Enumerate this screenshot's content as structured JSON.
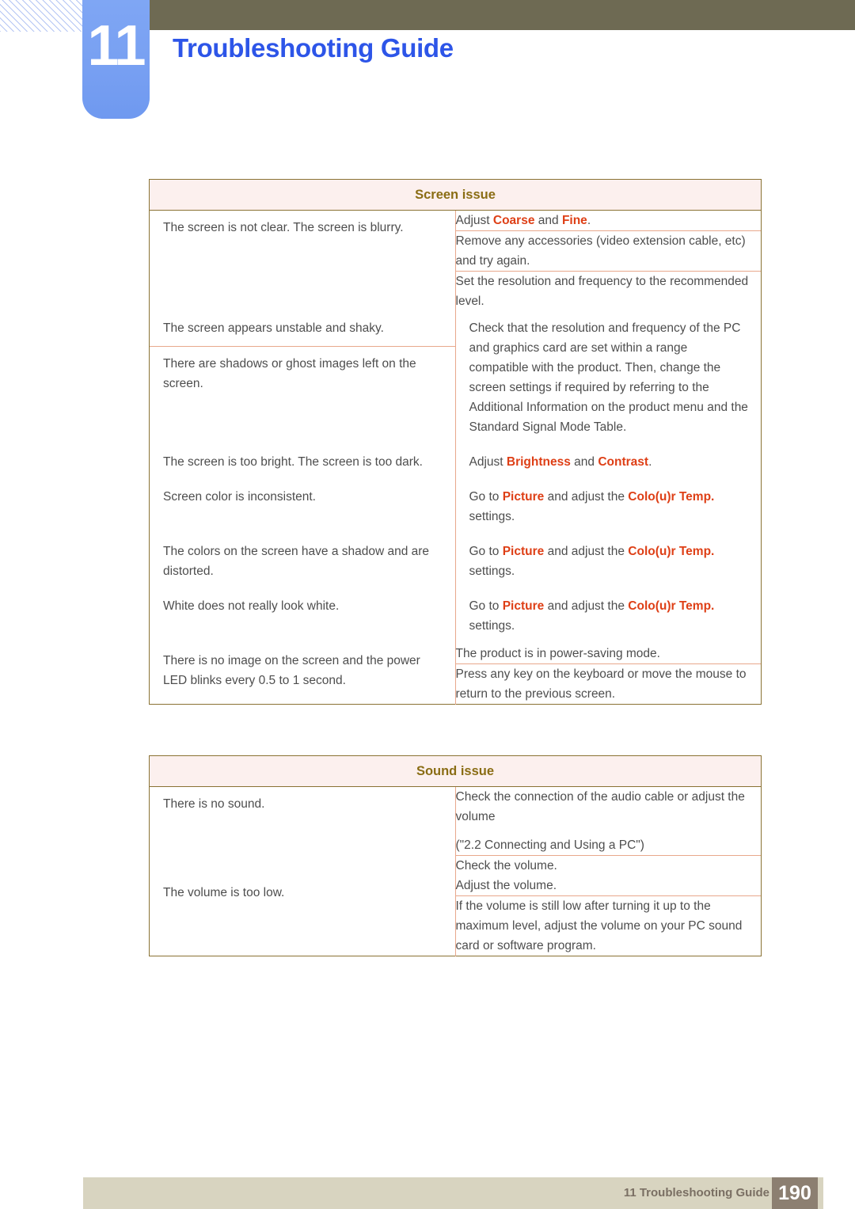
{
  "header": {
    "chapter_number": "11",
    "title": "Troubleshooting Guide",
    "title_color": "#2d55e8",
    "badge_color": "#7fa6f4",
    "bar_color": "#6e6a53"
  },
  "footer": {
    "label": "11 Troubleshooting Guide",
    "page_number": "190",
    "bar_color": "#d8d4c0",
    "page_box_color": "#8c7f71"
  },
  "colors": {
    "table_border": "#8a7233",
    "inner_border": "#e8a88c",
    "section_header_bg": "#fcf0ee",
    "section_header_text": "#8a6d14",
    "highlight": "#de3f16",
    "body_text": "#4e4e4e"
  },
  "tables": [
    {
      "section_title": "Screen issue",
      "rows": [
        {
          "symptom": "The screen is not clear. The screen is blurry.",
          "solutions": [
            {
              "parts": [
                {
                  "t": "Adjust ",
                  "b": false
                },
                {
                  "t": "Coarse",
                  "b": true
                },
                {
                  "t": " and ",
                  "b": false
                },
                {
                  "t": "Fine",
                  "b": true
                },
                {
                  "t": ".",
                  "b": false
                }
              ]
            },
            {
              "parts": [
                {
                  "t": "Remove any accessories (video extension cable, etc) and try again.",
                  "b": false
                }
              ]
            },
            {
              "parts": [
                {
                  "t": "Set the resolution and frequency to the recommended level.",
                  "b": false
                }
              ]
            }
          ]
        },
        {
          "symptom": "The screen appears unstable and shaky.",
          "symptom2": "There are shadows or ghost images left on the screen.",
          "solutions": [
            {
              "parts": [
                {
                  "t": "Check that the resolution and frequency of the PC and graphics card are set within a range compatible with the product. Then, change the screen settings if required by referring to the Additional Information on the product menu and the Standard Signal Mode Table.",
                  "b": false
                }
              ]
            }
          ]
        },
        {
          "symptom": "The screen is too bright. The screen is too dark.",
          "solutions": [
            {
              "parts": [
                {
                  "t": "Adjust ",
                  "b": false
                },
                {
                  "t": "Brightness",
                  "b": true
                },
                {
                  "t": " and ",
                  "b": false
                },
                {
                  "t": "Contrast",
                  "b": true
                },
                {
                  "t": ".",
                  "b": false
                }
              ]
            }
          ]
        },
        {
          "symptom": "Screen color is inconsistent.",
          "solutions": [
            {
              "parts": [
                {
                  "t": "Go to ",
                  "b": false
                },
                {
                  "t": "Picture",
                  "b": true
                },
                {
                  "t": " and adjust the ",
                  "b": false
                },
                {
                  "t": "Colo(u)r Temp.",
                  "b": true
                },
                {
                  "t": " settings.",
                  "b": false
                }
              ]
            }
          ]
        },
        {
          "symptom": "The colors on the screen have a shadow and are distorted.",
          "solutions": [
            {
              "parts": [
                {
                  "t": "Go to ",
                  "b": false
                },
                {
                  "t": "Picture",
                  "b": true
                },
                {
                  "t": " and adjust the ",
                  "b": false
                },
                {
                  "t": "Colo(u)r Temp.",
                  "b": true
                },
                {
                  "t": " settings.",
                  "b": false
                }
              ]
            }
          ]
        },
        {
          "symptom": "White does not really look white.",
          "solutions": [
            {
              "parts": [
                {
                  "t": "Go to ",
                  "b": false
                },
                {
                  "t": "Picture",
                  "b": true
                },
                {
                  "t": " and adjust the ",
                  "b": false
                },
                {
                  "t": "Colo(u)r Temp.",
                  "b": true
                },
                {
                  "t": " settings.",
                  "b": false
                }
              ]
            }
          ]
        },
        {
          "symptom": "There is no image on the screen and the power LED blinks every 0.5 to 1 second.",
          "solutions": [
            {
              "parts": [
                {
                  "t": "The product is in power-saving mode.",
                  "b": false
                }
              ]
            },
            {
              "parts": [
                {
                  "t": "Press any key on the keyboard or move the mouse to return to the previous screen.",
                  "b": false
                }
              ]
            }
          ]
        }
      ]
    },
    {
      "section_title": "Sound issue",
      "rows": [
        {
          "symptom": "There is no sound.",
          "solutions": [
            {
              "parts": [
                {
                  "t": "Check the connection of the audio cable or adjust the volume",
                  "b": false
                }
              ],
              "extra": "(\"2.2 Connecting and Using a PC\")"
            },
            {
              "parts": [
                {
                  "t": "Check the volume.",
                  "b": false
                }
              ]
            }
          ]
        },
        {
          "symptom": "The volume is too low.",
          "solutions": [
            {
              "parts": [
                {
                  "t": "Adjust the volume.",
                  "b": false
                }
              ]
            },
            {
              "parts": [
                {
                  "t": "If the volume is still low after turning it up to the maximum level, adjust the volume on your PC sound card or software program.",
                  "b": false
                }
              ]
            }
          ]
        }
      ]
    }
  ]
}
